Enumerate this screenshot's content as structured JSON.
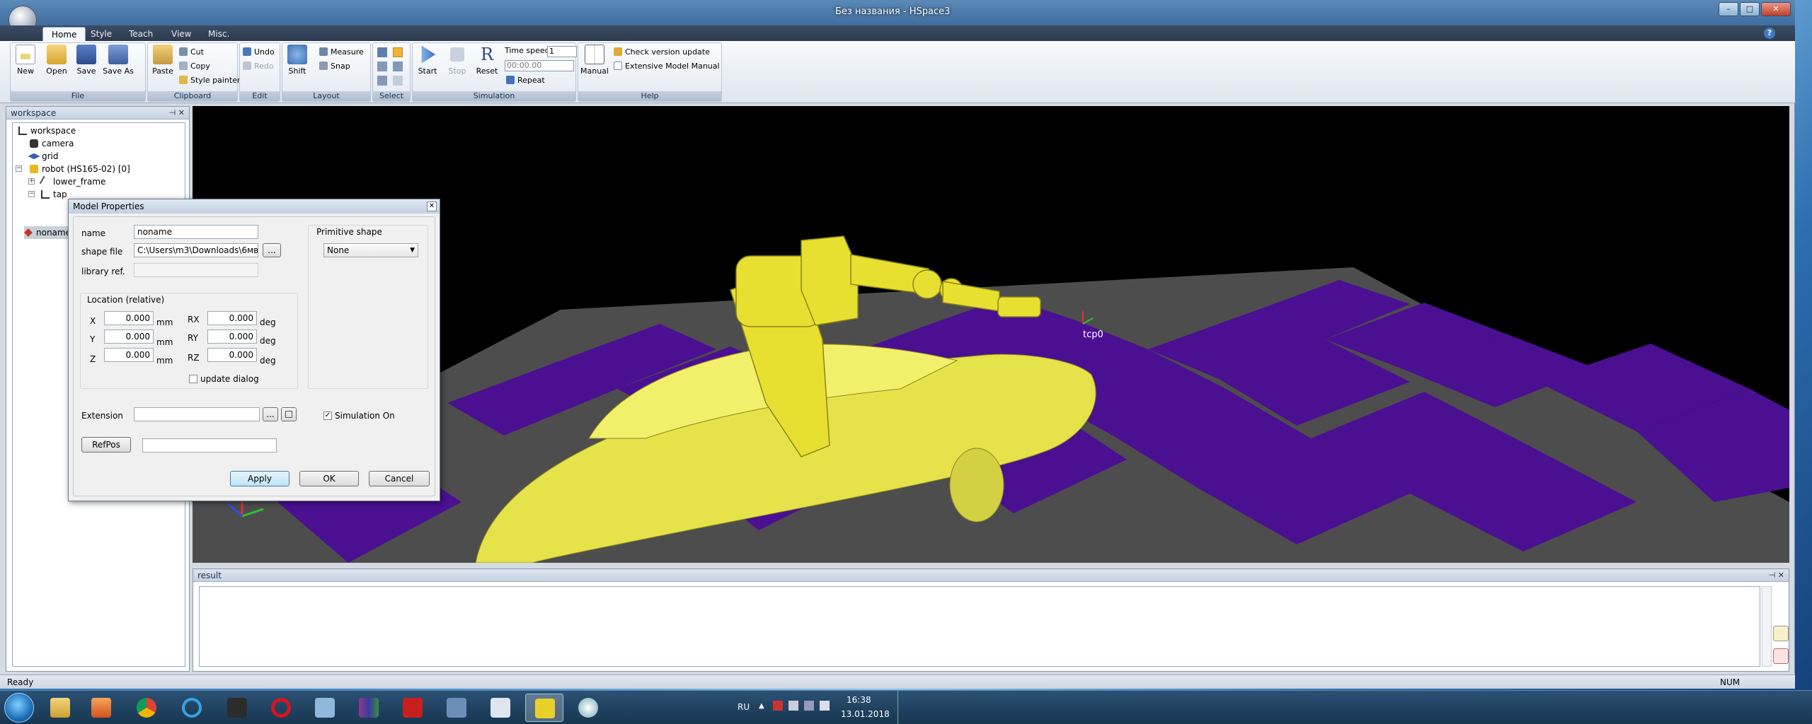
{
  "window": {
    "title": "Без названия - HSpace3",
    "minimize": "–",
    "maximize": "□",
    "close": "✕"
  },
  "tabs": [
    "Home",
    "Style",
    "Teach",
    "View",
    "Misc."
  ],
  "ribbon": {
    "file": {
      "label": "File",
      "new": "New",
      "open": "Open",
      "save": "Save",
      "save_as": "Save As"
    },
    "clipboard": {
      "label": "Clipboard",
      "paste": "Paste",
      "cut": "Cut",
      "copy": "Copy",
      "style_painter": "Style painter"
    },
    "edit": {
      "label": "Edit",
      "undo": "Undo",
      "redo": "Redo"
    },
    "layout": {
      "label": "Layout",
      "shift": "Shift",
      "measure": "Measure",
      "snap": "Snap"
    },
    "select": {
      "label": "Select"
    },
    "simulation": {
      "label": "Simulation",
      "start": "Start",
      "stop": "Stop",
      "reset": "Reset",
      "time_speed_label": "Time speed",
      "time_speed_value": "1",
      "time_value": "00:00.00",
      "repeat": "Repeat"
    },
    "help": {
      "label": "Help",
      "manual": "Manual",
      "check_update": "Check version update",
      "extensive_manual": "Extensive Model Manual"
    }
  },
  "workspace_panel": {
    "title": "workspace",
    "pin": "⊣ ✕",
    "tree": [
      "workspace",
      "camera",
      "grid",
      "robot (HS165-02) [0]",
      "lower_frame",
      "tap",
      "noname"
    ]
  },
  "viewport": {
    "tcp_label": "tcp0"
  },
  "result_panel": {
    "title": "result",
    "pin": "⊣ ✕"
  },
  "status": {
    "text": "Ready",
    "num": "NUM"
  },
  "dialog": {
    "title": "Model Properties",
    "close": "✕",
    "name_label": "name",
    "name_value": "noname",
    "shape_label": "shape file",
    "shape_value": "C:\\Users\\m3\\Downloads\\6мв",
    "browse": "...",
    "library_label": "library ref.",
    "location_title": "Location (relative)",
    "x_label": "X",
    "x_value": "0.000",
    "y_label": "Y",
    "y_value": "0.000",
    "z_label": "Z",
    "z_value": "0.000",
    "rx_label": "RX",
    "rx_value": "0.000",
    "ry_label": "RY",
    "ry_value": "0.000",
    "rz_label": "RZ",
    "rz_value": "0.000",
    "mm": "mm",
    "deg": "deg",
    "update_dialog": "update dialog",
    "primitive_title": "Primitive shape",
    "primitive_value": "None",
    "extension_label": "Extension",
    "simulation_on": "Simulation On",
    "refpos": "RefPos",
    "apply": "Apply",
    "ok": "OK",
    "cancel": "Cancel"
  },
  "taskbar": {
    "lang": "RU",
    "time": "16:38",
    "date": "13.01.2018"
  }
}
